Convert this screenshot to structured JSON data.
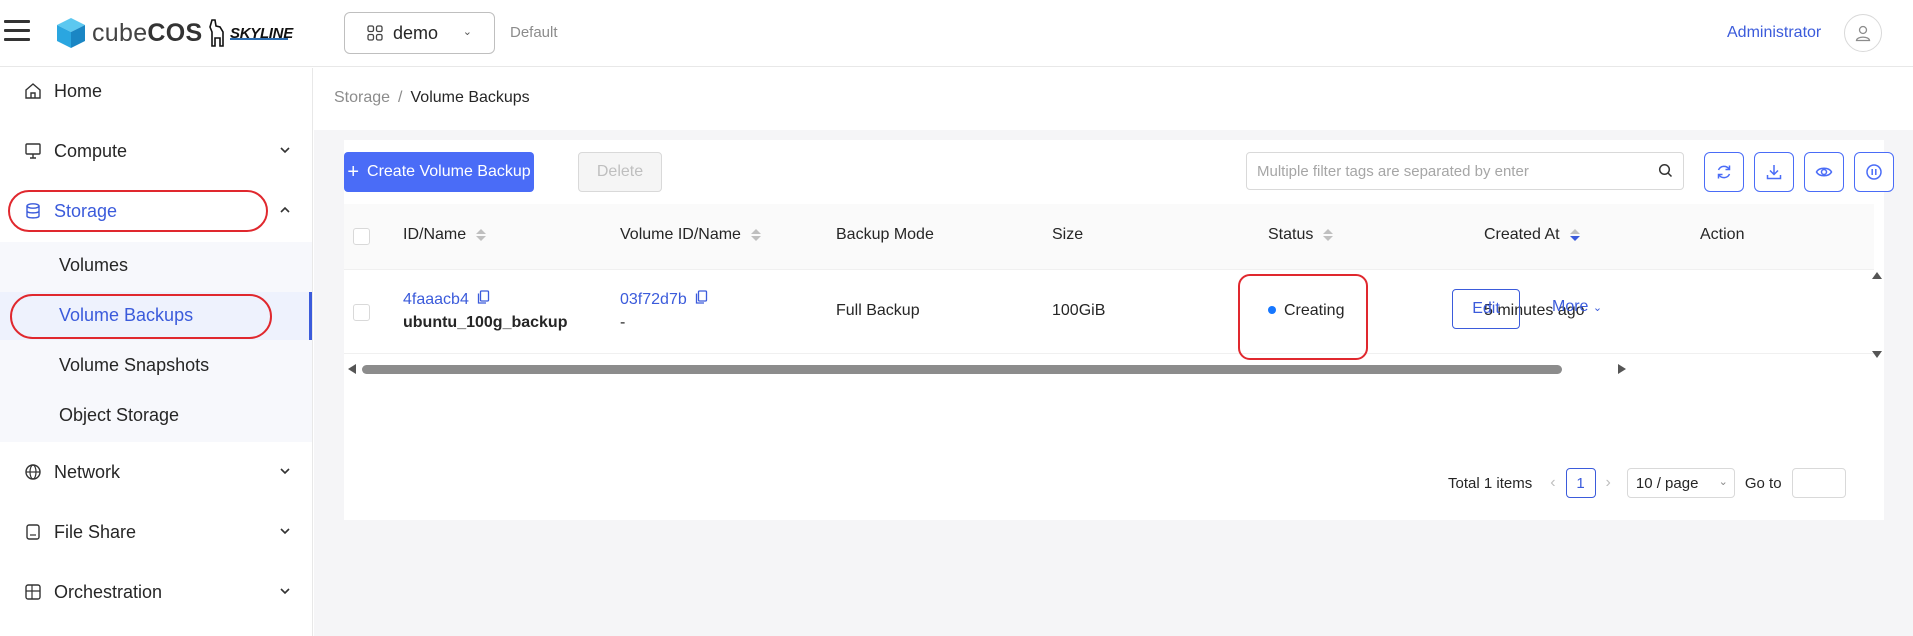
{
  "header": {
    "brand_light": "cube",
    "brand_bold": "COS",
    "partner": "SKYLINE",
    "project": "demo",
    "region": "Default",
    "user": "Administrator"
  },
  "sidebar": {
    "items": [
      {
        "label": "Home",
        "icon": "home-icon"
      },
      {
        "label": "Compute",
        "icon": "monitor-icon"
      },
      {
        "label": "Storage",
        "icon": "database-icon"
      },
      {
        "label": "Network",
        "icon": "globe-icon"
      },
      {
        "label": "File Share",
        "icon": "file-share-icon"
      },
      {
        "label": "Orchestration",
        "icon": "orchestration-icon"
      }
    ],
    "storage_sub": [
      "Volumes",
      "Volume Backups",
      "Volume Snapshots",
      "Object Storage"
    ]
  },
  "breadcrumb": {
    "parent": "Storage",
    "separator": "/",
    "current": "Volume Backups"
  },
  "toolbar": {
    "create_label": "Create Volume Backup",
    "delete_label": "Delete",
    "search_placeholder": "Multiple filter tags are separated by enter"
  },
  "table": {
    "headers": [
      "ID/Name",
      "Volume ID/Name",
      "Backup Mode",
      "Size",
      "Status",
      "Created At",
      "Action"
    ],
    "rows": [
      {
        "id": "4faaacb4",
        "name": "ubuntu_100g_backup",
        "volume_id": "03f72d7b",
        "volume_name": "-",
        "mode": "Full Backup",
        "size": "100GiB",
        "status": "Creating",
        "created": "5 minutes ago",
        "edit": "Edit",
        "more": "More"
      }
    ]
  },
  "pagination": {
    "total": "Total 1 items",
    "current_page": "1",
    "page_size": "10 / page",
    "goto": "Go to"
  },
  "colors": {
    "accent": "#3b5bdb",
    "primary_button": "#4a6cf7",
    "highlight": "#e0282e",
    "status_creating": "#1677ff"
  }
}
